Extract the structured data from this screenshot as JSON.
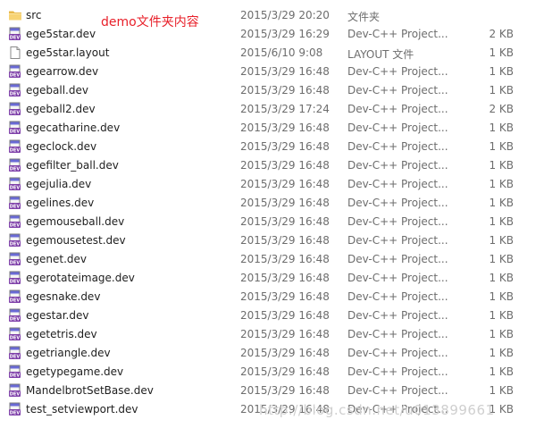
{
  "annotation": "demo文件夹内容",
  "watermark": "http://blog.csdn.net/u013899661",
  "files": [
    {
      "name": "src",
      "date": "2015/3/29 20:20",
      "type": "文件夹",
      "size": "",
      "icon": "folder-icon"
    },
    {
      "name": "ege5star.dev",
      "date": "2015/3/29 16:29",
      "type": "Dev-C++ Project...",
      "size": "2 KB",
      "icon": "devcpp-project-icon"
    },
    {
      "name": "ege5star.layout",
      "date": "2015/6/10 9:08",
      "type": "LAYOUT 文件",
      "size": "1 KB",
      "icon": "document-icon"
    },
    {
      "name": "egearrow.dev",
      "date": "2015/3/29 16:48",
      "type": "Dev-C++ Project...",
      "size": "1 KB",
      "icon": "devcpp-project-icon"
    },
    {
      "name": "egeball.dev",
      "date": "2015/3/29 16:48",
      "type": "Dev-C++ Project...",
      "size": "1 KB",
      "icon": "devcpp-project-icon"
    },
    {
      "name": "egeball2.dev",
      "date": "2015/3/29 17:24",
      "type": "Dev-C++ Project...",
      "size": "2 KB",
      "icon": "devcpp-project-icon"
    },
    {
      "name": "egecatharine.dev",
      "date": "2015/3/29 16:48",
      "type": "Dev-C++ Project...",
      "size": "1 KB",
      "icon": "devcpp-project-icon"
    },
    {
      "name": "egeclock.dev",
      "date": "2015/3/29 16:48",
      "type": "Dev-C++ Project...",
      "size": "1 KB",
      "icon": "devcpp-project-icon"
    },
    {
      "name": "egefilter_ball.dev",
      "date": "2015/3/29 16:48",
      "type": "Dev-C++ Project...",
      "size": "1 KB",
      "icon": "devcpp-project-icon"
    },
    {
      "name": "egejulia.dev",
      "date": "2015/3/29 16:48",
      "type": "Dev-C++ Project...",
      "size": "1 KB",
      "icon": "devcpp-project-icon"
    },
    {
      "name": "egelines.dev",
      "date": "2015/3/29 16:48",
      "type": "Dev-C++ Project...",
      "size": "1 KB",
      "icon": "devcpp-project-icon"
    },
    {
      "name": "egemouseball.dev",
      "date": "2015/3/29 16:48",
      "type": "Dev-C++ Project...",
      "size": "1 KB",
      "icon": "devcpp-project-icon"
    },
    {
      "name": "egemousetest.dev",
      "date": "2015/3/29 16:48",
      "type": "Dev-C++ Project...",
      "size": "1 KB",
      "icon": "devcpp-project-icon"
    },
    {
      "name": "egenet.dev",
      "date": "2015/3/29 16:48",
      "type": "Dev-C++ Project...",
      "size": "1 KB",
      "icon": "devcpp-project-icon"
    },
    {
      "name": "egerotateimage.dev",
      "date": "2015/3/29 16:48",
      "type": "Dev-C++ Project...",
      "size": "1 KB",
      "icon": "devcpp-project-icon"
    },
    {
      "name": "egesnake.dev",
      "date": "2015/3/29 16:48",
      "type": "Dev-C++ Project...",
      "size": "1 KB",
      "icon": "devcpp-project-icon"
    },
    {
      "name": "egestar.dev",
      "date": "2015/3/29 16:48",
      "type": "Dev-C++ Project...",
      "size": "1 KB",
      "icon": "devcpp-project-icon"
    },
    {
      "name": "egetetris.dev",
      "date": "2015/3/29 16:48",
      "type": "Dev-C++ Project...",
      "size": "1 KB",
      "icon": "devcpp-project-icon"
    },
    {
      "name": "egetriangle.dev",
      "date": "2015/3/29 16:48",
      "type": "Dev-C++ Project...",
      "size": "1 KB",
      "icon": "devcpp-project-icon"
    },
    {
      "name": "egetypegame.dev",
      "date": "2015/3/29 16:48",
      "type": "Dev-C++ Project...",
      "size": "1 KB",
      "icon": "devcpp-project-icon"
    },
    {
      "name": "MandelbrotSetBase.dev",
      "date": "2015/3/29 16:48",
      "type": "Dev-C++ Project...",
      "size": "1 KB",
      "icon": "devcpp-project-icon"
    },
    {
      "name": "test_setviewport.dev",
      "date": "2015/3/29 16:48",
      "type": "Dev-C++ Project...",
      "size": "1 KB",
      "icon": "devcpp-project-icon"
    }
  ]
}
